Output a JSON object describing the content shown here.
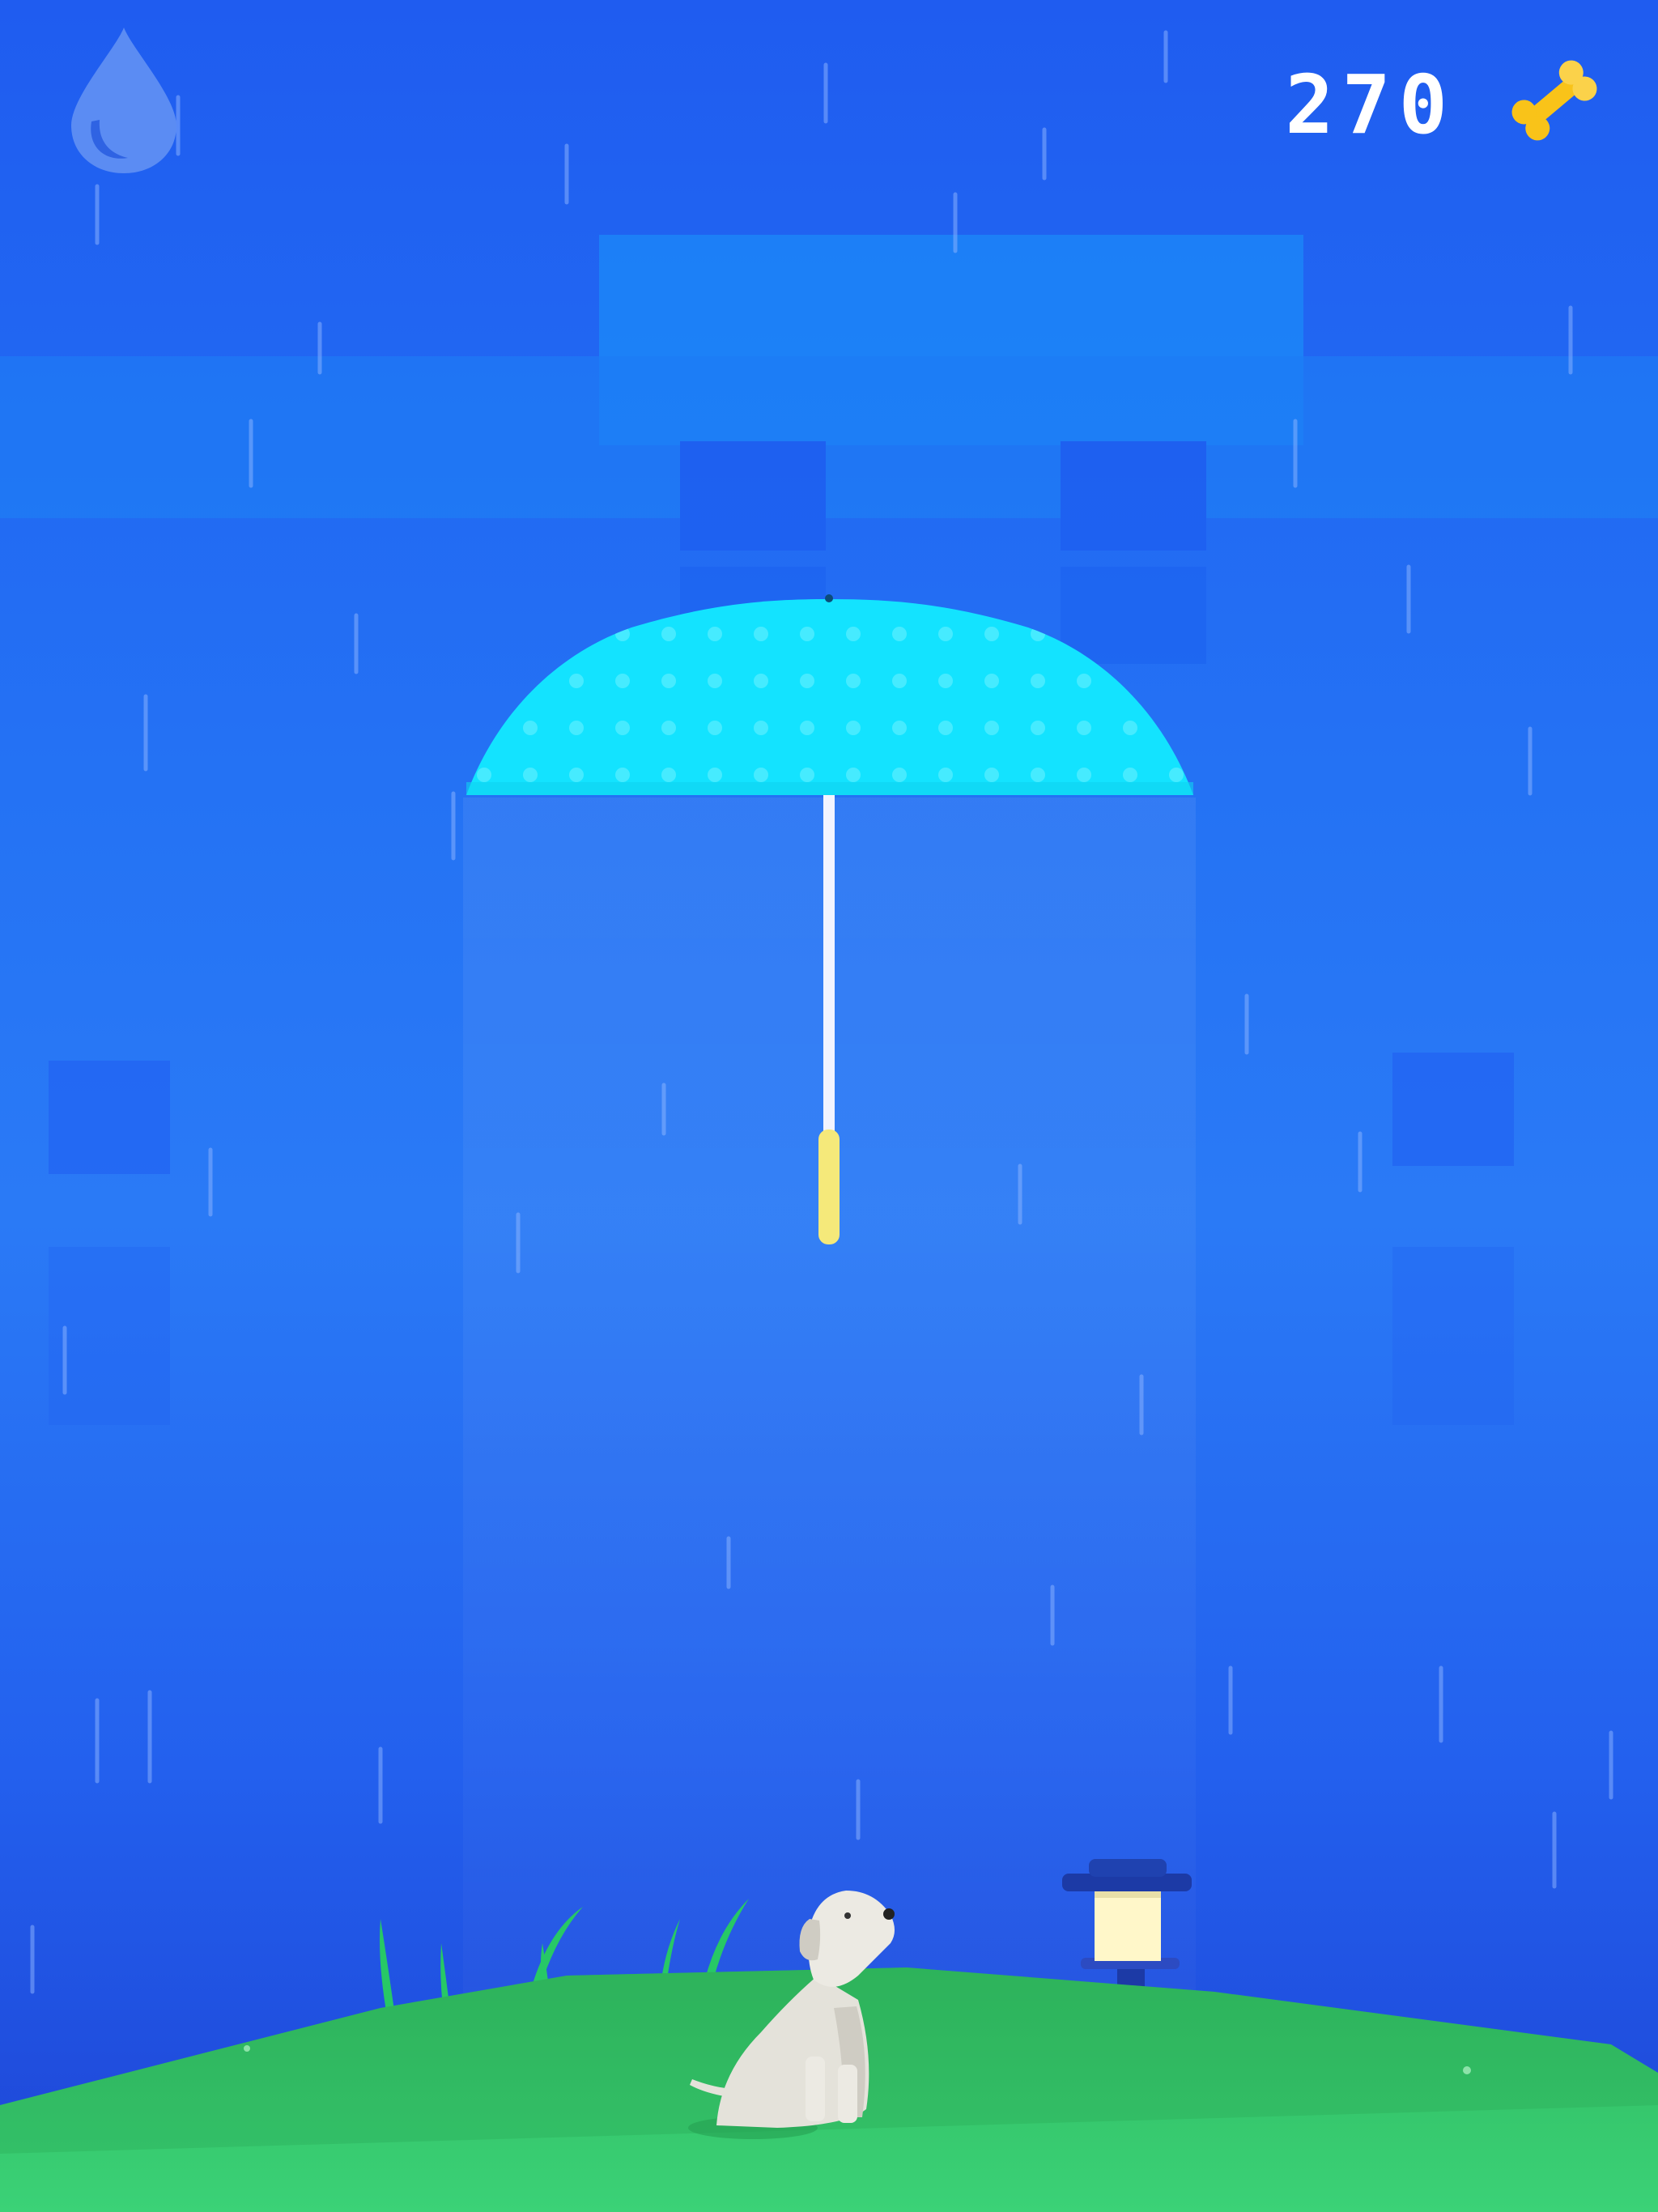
{
  "hud": {
    "score": "270",
    "drop_icon": "water-drop-icon",
    "bone_icon": "bone-icon"
  },
  "colors": {
    "sky": "#2472f4",
    "umbrella_canopy": "#13e3ff",
    "umbrella_handle": "#f5e97a",
    "grass": "#34c86a",
    "dog": "#e4e2da",
    "lamp_post": "#1c3aa6",
    "lamp_light": "#fff7c9"
  }
}
